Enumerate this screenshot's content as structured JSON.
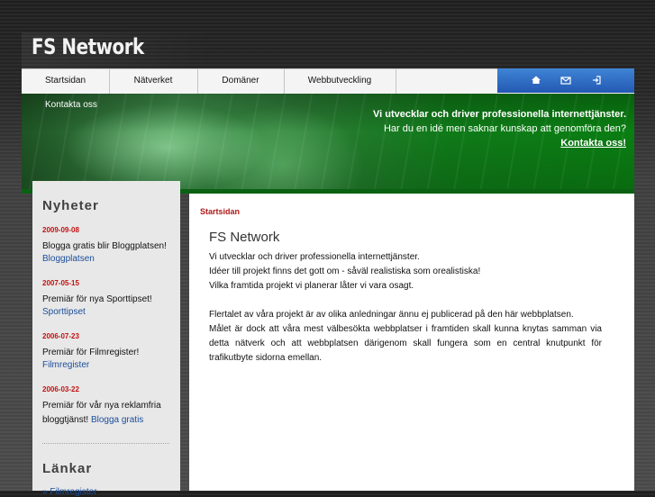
{
  "site": {
    "logo_text": "FS Network"
  },
  "nav": {
    "items": [
      {
        "label": "Startsidan"
      },
      {
        "label": "Nätverket"
      },
      {
        "label": "Domäner"
      },
      {
        "label": "Webbutveckling"
      }
    ],
    "icons": [
      "home-icon",
      "mail-icon",
      "login-icon"
    ]
  },
  "banner": {
    "contact_label": "Kontakta oss",
    "line1": "Vi utvecklar och driver professionella internettjänster.",
    "line2": "Har du en idé men saknar kunskap att genomföra den?",
    "link": "Kontakta oss!"
  },
  "sidebar": {
    "news_title": "Nyheter",
    "news": [
      {
        "date": "2009-09-08",
        "text": "Blogga gratis blir Bloggplatsen!",
        "link": "Bloggplatsen"
      },
      {
        "date": "2007-05-15",
        "text": "Premiär för nya Sporttipset!",
        "link": "Sporttipset"
      },
      {
        "date": "2006-07-23",
        "text": "Premiär för Filmregister!",
        "link": "Filmregister"
      },
      {
        "date": "2006-03-22",
        "text": "Premiär för vår nya reklamfria bloggtjänst!",
        "link": "Blogga gratis"
      }
    ],
    "links_title": "Länkar",
    "links": [
      {
        "label": "Filmregister"
      }
    ]
  },
  "main": {
    "breadcrumb": "Startsidan",
    "title": "FS Network",
    "paragraph1": [
      "Vi utvecklar och driver professionella internettjänster.",
      "Idéer till projekt finns det gott om - såväl realistiska som orealistiska!",
      "Vilka framtida projekt vi planerar låter vi vara osagt."
    ],
    "paragraph2": [
      "Flertalet av våra projekt är av olika anledningar ännu ej publicerad på den här webbplatsen.",
      "Målet är dock att våra mest välbesökta webbplatser i framtiden skall kunna knytas samman via detta nätverk och att webbplatsen därigenom skall fungera som en central knutpunkt för trafikutbyte sidorna emellan."
    ]
  },
  "colors": {
    "accent_green": "#0e9a22",
    "nav_blue": "#2f6cc4",
    "date_red": "#c01212",
    "link_blue": "#1b4d9a"
  }
}
